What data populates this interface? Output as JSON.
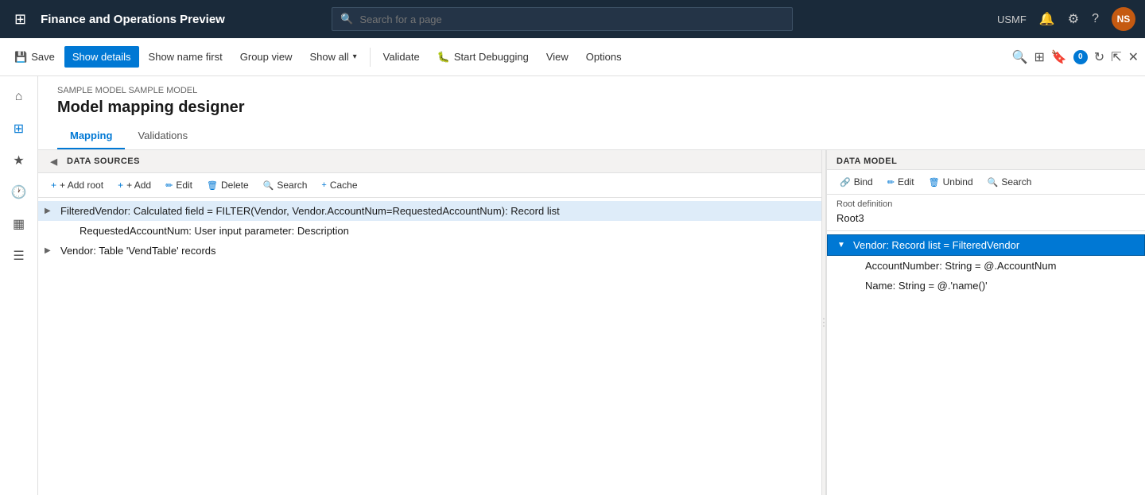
{
  "app": {
    "title": "Finance and Operations Preview",
    "search_placeholder": "Search for a page"
  },
  "top_nav": {
    "region": "USMF",
    "avatar_initials": "NS"
  },
  "toolbar": {
    "save_label": "Save",
    "show_details_label": "Show details",
    "show_name_first_label": "Show name first",
    "group_view_label": "Group view",
    "show_all_label": "Show all",
    "validate_label": "Validate",
    "start_debugging_label": "Start Debugging",
    "view_label": "View",
    "options_label": "Options"
  },
  "breadcrumb": "SAMPLE MODEL SAMPLE MODEL",
  "page_title": "Model mapping designer",
  "tabs": [
    {
      "id": "mapping",
      "label": "Mapping",
      "active": true
    },
    {
      "id": "validations",
      "label": "Validations",
      "active": false
    }
  ],
  "data_sources": {
    "panel_label": "DATA SOURCES",
    "toolbar": {
      "add_root": "+ Add root",
      "add": "+ Add",
      "edit": "Edit",
      "delete": "Delete",
      "search": "Search",
      "cache": "Cache"
    },
    "items": [
      {
        "id": "filtered-vendor",
        "label": "FilteredVendor: Calculated field = FILTER(Vendor, Vendor.AccountNum=RequestedAccountNum): Record list",
        "indent": 0,
        "has_children": true,
        "expanded": false,
        "selected": true
      },
      {
        "id": "requested-account-num",
        "label": "RequestedAccountNum: User input parameter: Description",
        "indent": 1,
        "has_children": false,
        "expanded": false,
        "selected": false
      },
      {
        "id": "vendor",
        "label": "Vendor: Table 'VendTable' records",
        "indent": 0,
        "has_children": true,
        "expanded": false,
        "selected": false
      }
    ]
  },
  "data_model": {
    "panel_label": "DATA MODEL",
    "toolbar": {
      "bind": "Bind",
      "edit": "Edit",
      "unbind": "Unbind",
      "search": "Search"
    },
    "root_definition_label": "Root definition",
    "root_definition_value": "Root3",
    "items": [
      {
        "id": "vendor-record",
        "label": "Vendor: Record list = FilteredVendor",
        "indent": 0,
        "has_children": true,
        "expanded": true,
        "selected": true
      },
      {
        "id": "account-number",
        "label": "AccountNumber: String = @.AccountNum",
        "indent": 1,
        "has_children": false,
        "selected": false
      },
      {
        "id": "name",
        "label": "Name: String = @.'name()'",
        "indent": 1,
        "has_children": false,
        "selected": false
      }
    ]
  }
}
